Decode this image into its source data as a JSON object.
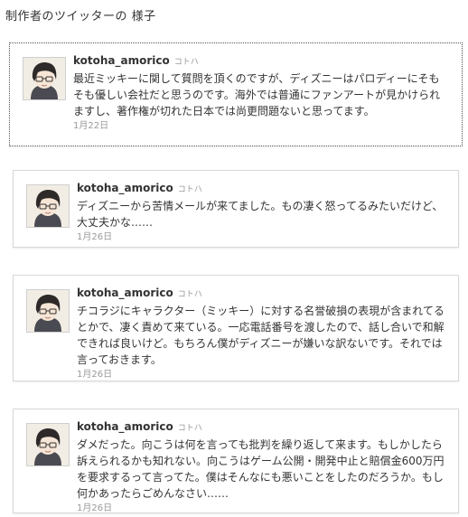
{
  "page": {
    "heading": "制作者のツイッターの 様子"
  },
  "tweets": [
    {
      "username": "kotoha_amorico",
      "fullname": "コトハ",
      "text": "最近ミッキーに関して質問を頂くのですが、ディズニーはパロディーにそもそも優しい会社だと思うのです。海外では普通にファンアートが見かけられますし、著作権が切れた日本では尚更問題ないと思ってます。",
      "date": "1月22日"
    },
    {
      "username": "kotoha_amorico",
      "fullname": "コトハ",
      "text": "ディズニーから苦情メールが来てました。もの凄く怒ってるみたいだけど、大丈夫かな……",
      "date": "1月26日"
    },
    {
      "username": "kotoha_amorico",
      "fullname": "コトハ",
      "text": "チコラジにキャラクター（ミッキー）に対する名誉破損の表現が含まれてるとかで、凄く責めて来ている。一応電話番号を渡したので、話し合いで和解できれば良いけど。もちろん僕がディズニーが嫌いな訳ないです。それでは言っておきます。",
      "date": "1月26日"
    },
    {
      "username": "kotoha_amorico",
      "fullname": "コトハ",
      "text": "ダメだった。向こうは何を言っても批判を繰り返して来ます。もしかしたら訴えられるかも知れない。向こうはゲーム公開・開発中止と賠償金600万円を要求するって言ってた。僕はそんなにも悪いことをしたのだろうか。もし何かあったらごめんなさい……",
      "date": "1月26日"
    }
  ]
}
